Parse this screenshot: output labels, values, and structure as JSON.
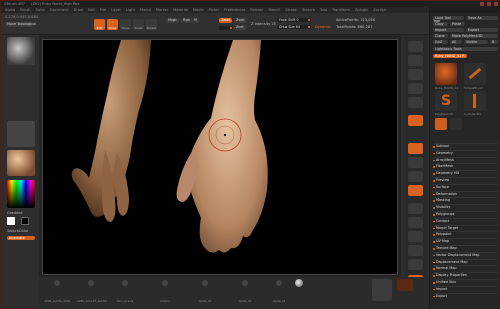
{
  "titlebar": {
    "app": "ZBrush 4R7",
    "file": "(Ztl2) Ruby Hand_High Res"
  },
  "menubar": {
    "items": [
      "Alpha",
      "Brush",
      "Color",
      "Document",
      "Draw",
      "Edit",
      "File",
      "Layer",
      "Light",
      "Macro",
      "Marker",
      "Material",
      "Movie",
      "Picker",
      "Preferences",
      "Render",
      "Stencil",
      "Stroke",
      "Texture",
      "Tool",
      "Transform",
      "Zplugin",
      "Zscript"
    ]
  },
  "shelf": {
    "brush_label": "Move Topological",
    "edit": "Edit",
    "draw": "Draw",
    "move": "Move",
    "scale": "Scale",
    "rotate": "Rotate",
    "mrgb": "Mrgb",
    "rgb": "Rgb",
    "m": "M",
    "zadd": "Zadd",
    "zsub": "Zsub",
    "zcut": "Zcut",
    "focal": "Focal Shift 0",
    "intensity": "Z Intensity 25",
    "draw_size": "Draw Size 64",
    "dynamic": "Dynamic",
    "active_points": "ActivePoints: 113,058",
    "total_points": "TotalPoints: 860,287",
    "coords": "0.279,0.045,0.884"
  },
  "left": {
    "gradient": "Gradient",
    "switch_color": "SwitchColor",
    "alternate": "Alternate"
  },
  "right": {
    "tool_title": "Tool",
    "load_tool": "Load Tool",
    "save_as": "Save As",
    "copy": "Copy",
    "paste": "Paste",
    "import": "Import",
    "export": "Export",
    "clone": "Clone",
    "make_poly": "Make PolyMesh3D",
    "goz": "GoZ",
    "all": "All",
    "visible": "Visible",
    "r": "R",
    "lightbox": "Lightbox ▸ Tools",
    "current_tool": "Ruby_HAND_01 R",
    "mesh1": "Ruby_HAND_01",
    "mesh2": "SimpleBrush",
    "mesh3": "PolyMesh3D",
    "mesh4": "Cylinder3D",
    "sections": [
      "Subtool",
      "Geometry",
      "ArrayMesh",
      "FiberMesh",
      "Geometry HD",
      "Preview",
      "Surface",
      "Deformation",
      "Masking",
      "Visibility",
      "Polygroups",
      "Contact",
      "Morph Target",
      "Polypaint",
      "UV Map",
      "Texture Map",
      "Vector Displacement Map",
      "Displacement Map",
      "Normal Map",
      "Display Properties",
      "Unified Skin",
      "Import",
      "Export"
    ]
  },
  "bottom": {
    "items": [
      "APPS_ALPHA_SKIN",
      "APPS_SCULPT_ALPHA",
      "Skin_Grains",
      "ZAlpha",
      "Alpha_01",
      "Alpha_02",
      "Alpha_03"
    ]
  },
  "colors": {
    "accent": "#d8621e",
    "canvas": "#000000"
  }
}
